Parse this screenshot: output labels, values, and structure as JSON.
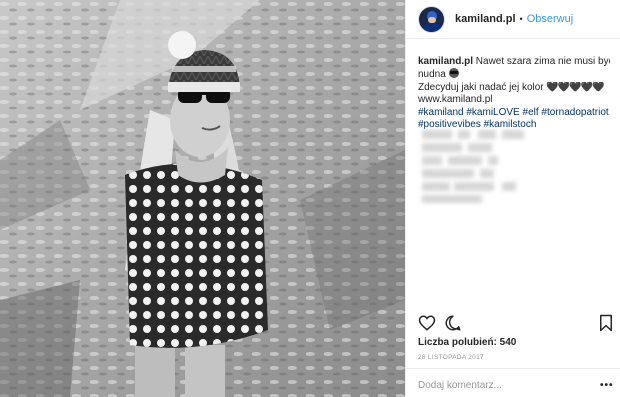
{
  "header": {
    "username": "kamiland.pl",
    "separator": "•",
    "follow_label": "Obserwuj"
  },
  "caption": {
    "username": "kamiland.pl",
    "line1": "Nawet szara zima nie musi być",
    "line2": "nudna",
    "line3": "Zdecyduj jaki nadać jej kolor",
    "hearts": "🖤🖤🖤🖤🖤",
    "website": "www.kamiland.pl",
    "hashtags_line1": [
      "#kamiland",
      "#kamiLOVE",
      "#elf",
      "#tornadopatriot"
    ],
    "hashtags_line2": [
      "#positivevibes",
      "#kamilstoch"
    ]
  },
  "actions": {
    "like_icon": "heart-icon",
    "comment_icon": "comment-icon",
    "save_icon": "bookmark-icon"
  },
  "likes": {
    "label": "Liczba polubień:",
    "count": "540"
  },
  "date": "28 LISTOPADA 2017",
  "comment_placeholder": "Dodaj komentarz...",
  "more_label": "•••",
  "colors": {
    "link": "#003569",
    "follow": "#3897f0",
    "muted": "#999999"
  }
}
